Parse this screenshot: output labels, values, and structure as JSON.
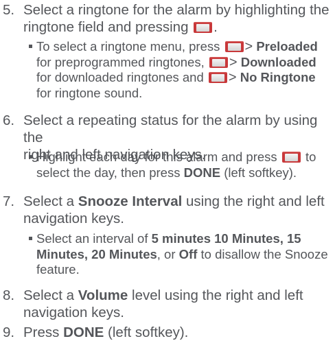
{
  "steps": [
    {
      "number": "5.",
      "line1": "Select a ringtone for the alarm by highlighting the",
      "line2": "ringtone field and pressing",
      "line2_end": ".",
      "bullet": {
        "l1_pre": "To select a ringtone menu, press",
        "l1_gt": ">",
        "l1_bold": "Preloaded",
        "l2_pre": "for preprogrammed ringtones,",
        "l2_gt": ">",
        "l2_bold": "Downloaded",
        "l3_pre": "for downloaded ringtones and",
        "l3_gt": ">",
        "l3_bold": "No Ringtone",
        "l4": "for ringtone sound."
      }
    },
    {
      "number": "6.",
      "line1": "Select a repeating status for the alarm by using the",
      "line2": "right and left navigation keys.",
      "bullet": {
        "l1_pre": "Highlight each day for this alarm and press",
        "l1_post": "to",
        "l2_pre": "select the day, then press",
        "l2_bold": "DONE",
        "l2_post": "(left softkey)."
      }
    },
    {
      "number": "7.",
      "line1_pre": "Select a",
      "line1_bold": "Snooze Interval",
      "line1_post": "using the right and left",
      "line2": "navigation keys.",
      "bullet": {
        "l1_pre": "Select an interval of",
        "l1_bold": "5 minutes 10 Minutes, 15",
        "l2_bold": "Minutes, 20 Minutes",
        "l2_mid": ", or",
        "l2_bold2": "Off",
        "l2_post": "to disallow the Snooze",
        "l3": "feature."
      }
    },
    {
      "number": "8.",
      "line1_pre": "Select a",
      "line1_bold": "Volume",
      "line1_post": "level using the right and left",
      "line2": "navigation keys."
    },
    {
      "number": "9.",
      "line1_pre": "Press",
      "line1_bold": "DONE",
      "line1_post": "(left softkey)."
    }
  ],
  "icons": {
    "menu_ok_key": "menu-ok-key-icon"
  },
  "colors": {
    "text": "#54565a",
    "key_accent": "#c8383a"
  }
}
